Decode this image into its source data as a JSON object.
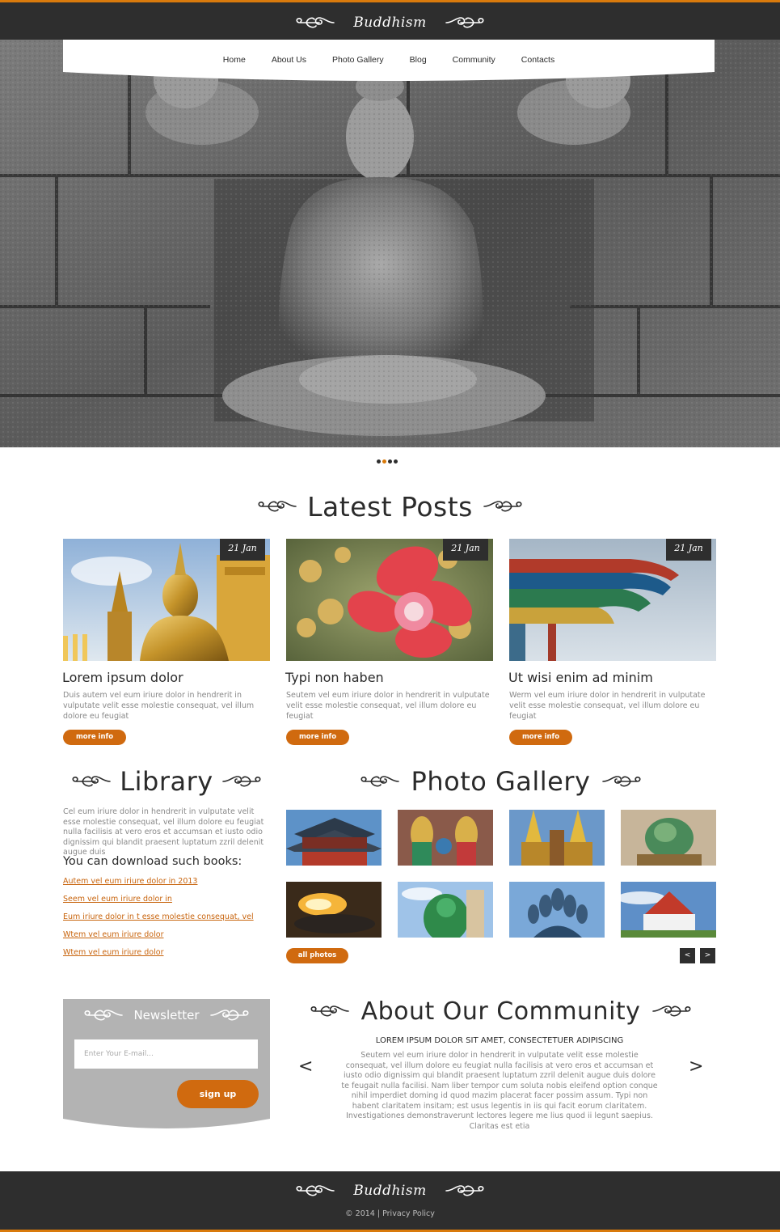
{
  "site": {
    "logo": "Buddhism",
    "accent": "#d97a0c",
    "dark": "#2e2e2e"
  },
  "nav": {
    "items": [
      "Home",
      "About Us",
      "Photo Gallery",
      "Blog",
      "Community",
      "Contacts"
    ]
  },
  "latest_posts": {
    "title": "Latest Posts",
    "posts": [
      {
        "date": "21 Jan",
        "title": "Lorem ipsum dolor",
        "text": "Duis autem vel eum iriure dolor in hendrerit in vulputate velit esse molestie consequat, vel illum dolore eu feugiat",
        "button": "more info"
      },
      {
        "date": "21 Jan",
        "title": "Typi non haben",
        "text": "Seutem vel eum iriure dolor in hendrerit in vulputate velit esse molestie consequat, vel illum dolore eu feugiat",
        "button": "more info"
      },
      {
        "date": "21 Jan",
        "title": "Ut wisi enim ad minim",
        "text": "Werm vel eum iriure dolor in hendrerit in vulputate velit esse molestie consequat, vel illum dolore eu feugiat",
        "button": "more info"
      }
    ]
  },
  "library": {
    "title": "Library",
    "text": "Cel eum iriure dolor in hendrerit in vulputate velit esse molestie consequat, vel illum dolore eu feugiat nulla facilisis at vero eros et accumsan et iusto odio dignissim qui blandit praesent luptatum zzril delenit augue duis",
    "subtitle": "You can download such books:",
    "links": [
      "Autem vel eum iriure dolor in 2013",
      "Seem vel eum iriure dolor in",
      "Eum iriure dolor in t esse molestie consequat, vel",
      "Wtem vel eum iriure dolor",
      "Wtem vel eum iriure dolor"
    ]
  },
  "gallery": {
    "title": "Photo Gallery",
    "button": "all photos",
    "prev": "<",
    "next": ">"
  },
  "newsletter": {
    "title": "Newsletter",
    "placeholder": "Enter Your E-mail...",
    "button": "sign up"
  },
  "community": {
    "title": "About Our Community",
    "subtitle": "LOREM IPSUM DOLOR SIT AMET, CONSECTETUER ADIPISCING",
    "text": "Seutem vel eum iriure dolor in hendrerit in vulputate velit esse molestie consequat, vel illum dolore eu feugiat nulla facilisis at vero eros et accumsan et iusto odio dignissim qui blandit praesent luptatum zzril delenit augue duis dolore te feugait nulla facilisi. Nam liber tempor cum soluta nobis eleifend option conque nihil imperdiet doming id quod mazim placerat facer possim assum. Typi non habent claritatem insitam; est usus legentis in iis qui facit eorum claritatem. Investigationes demonstraverunt lectores legere me lius quod ii legunt saepius. Claritas est etia",
    "prev": "<",
    "next": ">"
  },
  "footer": {
    "logo": "Buddhism",
    "copyright": "© 2014 | Privacy Policy"
  }
}
